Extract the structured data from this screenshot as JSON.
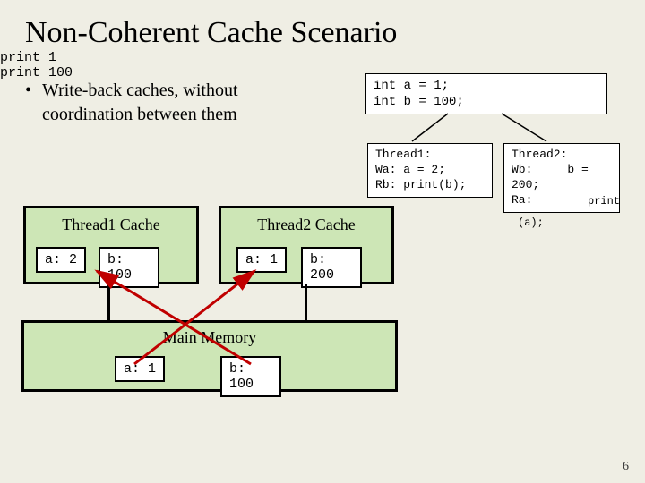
{
  "title": "Non-Coherent Cache Scenario",
  "bullet": "Write-back caches, without coordination between them",
  "code": {
    "globals": "int a = 1;\nint b = 100;",
    "thread1": "Thread1:\nWa: a = 2;\nRb: print(b);",
    "thread2": "Thread2:\nWb:     b =\n200;\nRa:",
    "extra_print_a": "(a);",
    "extra_print": "print"
  },
  "outputs": {
    "line1": "print 1",
    "line2": "print 100"
  },
  "cache1": {
    "title": "Thread1 Cache",
    "a": "a: 2",
    "b": "b: 100"
  },
  "cache2": {
    "title": "Thread2 Cache",
    "a": "a: 1",
    "b": "b: 200"
  },
  "memory": {
    "title": "Main Memory",
    "a": "a: 1",
    "b": "b: 100"
  },
  "pagenum": "6"
}
